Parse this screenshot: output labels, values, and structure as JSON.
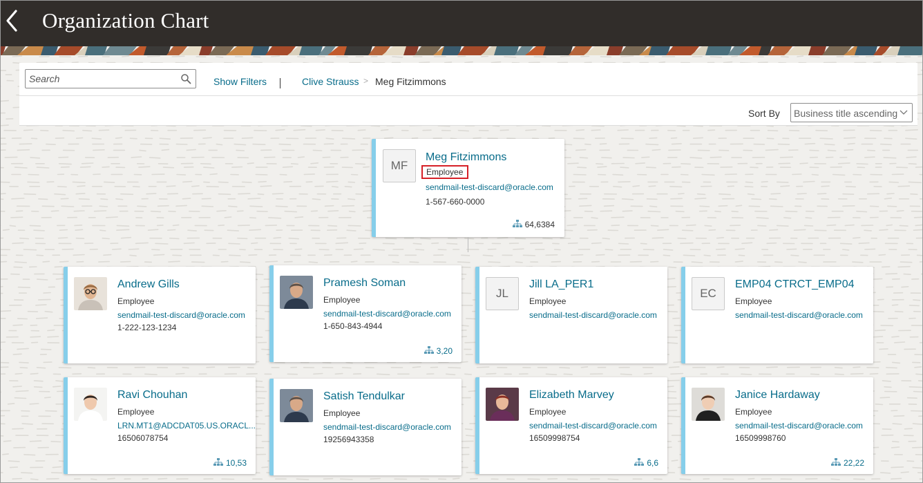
{
  "header": {
    "title": "Organization Chart"
  },
  "toolbar": {
    "search_placeholder": "Search",
    "show_filters": "Show Filters",
    "breadcrumb": [
      "Clive Strauss",
      "Meg Fitzimmons"
    ],
    "breadcrumb_separator": ">"
  },
  "sort": {
    "label": "Sort By",
    "selected": "Business title ascending"
  },
  "colors": {
    "header_bg": "#312d2a",
    "link": "#086c8a",
    "card_accent": "#86ceea",
    "highlight_box": "#d61f26"
  },
  "manager": {
    "initials": "MF",
    "name": "Meg Fitzimmons",
    "role": "Employee",
    "email": "sendmail-test-discard@oracle.com",
    "phone": "1-567-660-0000",
    "reports": "64,6384"
  },
  "reports": [
    {
      "name": "Andrew Gills",
      "role": "Employee",
      "email": "sendmail-test-discard@oracle.com",
      "phone": "1-222-123-1234",
      "reports": "",
      "avatar": "photo",
      "initials": ""
    },
    {
      "name": "Pramesh Soman",
      "role": "Employee",
      "email": "sendmail-test-discard@oracle.com",
      "phone": "1-650-843-4944",
      "reports": "3,20",
      "avatar": "photo",
      "initials": ""
    },
    {
      "name": "Jill LA_PER1",
      "role": "Employee",
      "email": "sendmail-test-discard@oracle.com",
      "phone": "",
      "reports": "",
      "avatar": "initials",
      "initials": "JL"
    },
    {
      "name": "EMP04 CTRCT_EMP04",
      "role": "Employee",
      "email": "sendmail-test-discard@oracle.com",
      "phone": "",
      "reports": "",
      "avatar": "initials",
      "initials": "EC"
    },
    {
      "name": "Ravi Chouhan",
      "role": "Employee",
      "email": "LRN.MT1@ADCDAT05.US.ORACL...",
      "phone": "16506078754",
      "reports": "10,53",
      "avatar": "photo",
      "initials": ""
    },
    {
      "name": "Satish Tendulkar",
      "role": "Employee",
      "email": "sendmail-test-discard@oracle.com",
      "phone": "19256943358",
      "reports": "",
      "avatar": "photo",
      "initials": ""
    },
    {
      "name": "Elizabeth Marvey",
      "role": "Employee",
      "email": "sendmail-test-discard@oracle.com",
      "phone": "16509998754",
      "reports": "6,6",
      "avatar": "photo",
      "initials": ""
    },
    {
      "name": "Janice Hardaway",
      "role": "Employee",
      "email": "sendmail-test-discard@oracle.com",
      "phone": "16509998760",
      "reports": "22,22",
      "avatar": "photo",
      "initials": ""
    }
  ]
}
